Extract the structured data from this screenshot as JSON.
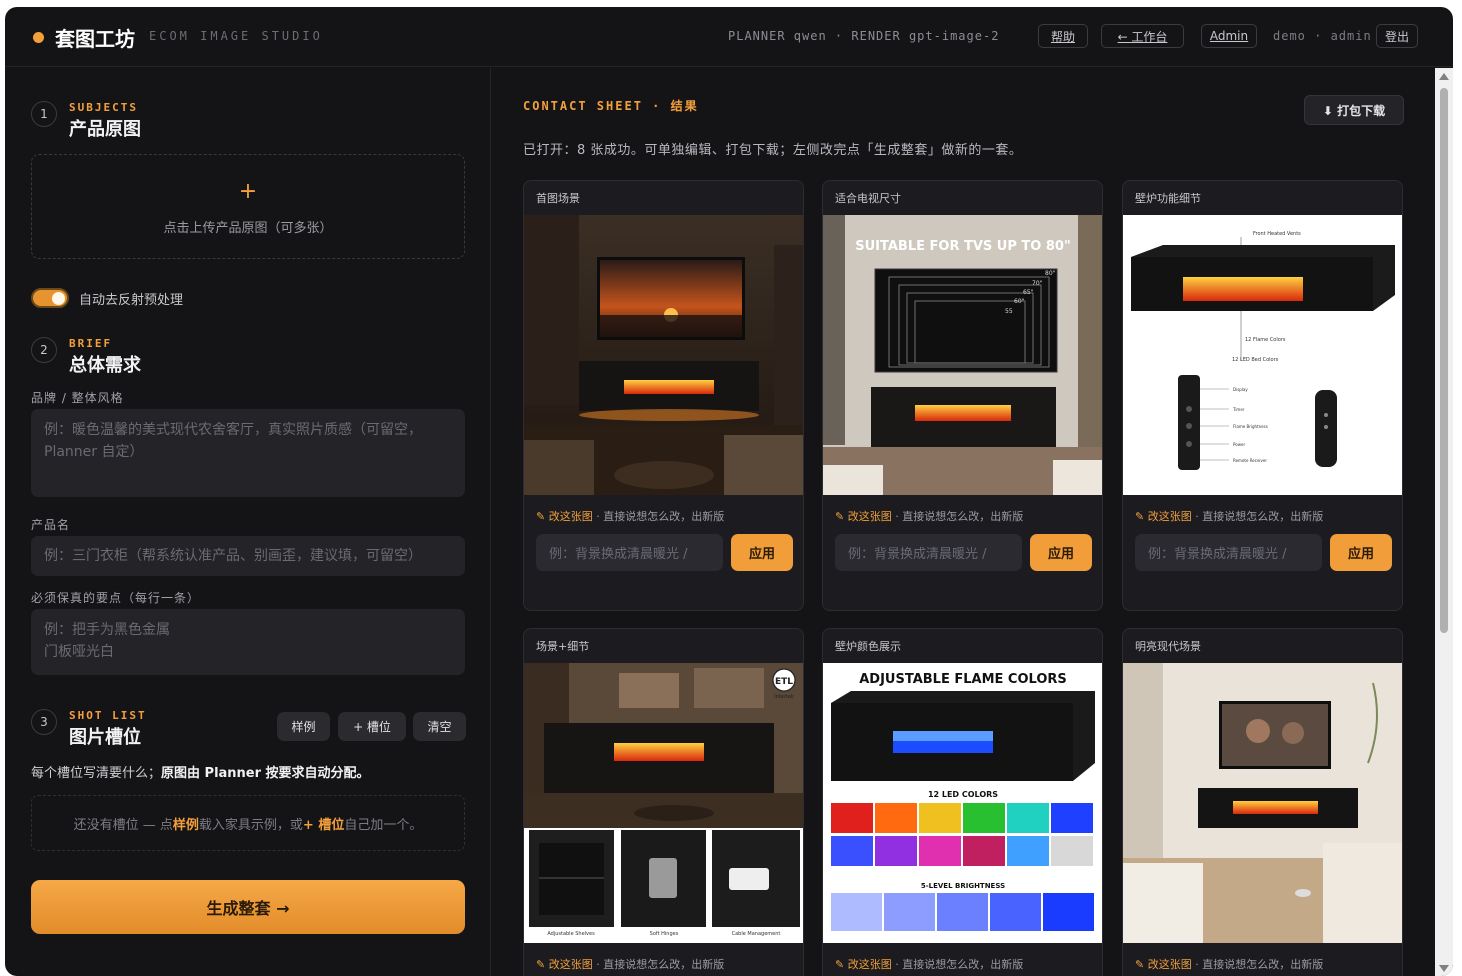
{
  "header": {
    "logo": "套图工坊",
    "subtitle": "ECOM IMAGE STUDIO",
    "model_info": "PLANNER qwen · RENDER gpt-image-2",
    "help": "帮助",
    "workspace": "← 工作台",
    "admin": "Admin",
    "user": "demo · admin",
    "logout": "登出"
  },
  "left": {
    "s1": {
      "num": "1",
      "kicker": "SUBJECTS",
      "title": "产品原图"
    },
    "upload": {
      "plus": "+",
      "text": "点击上传产品原图（可多张）"
    },
    "toggle": {
      "label": "自动去反射预处理",
      "on": true
    },
    "s2": {
      "num": "2",
      "kicker": "BRIEF",
      "title": "总体需求"
    },
    "brand_label": "品牌 / 整体风格",
    "brand_placeholder": "例：暖色温馨的美式现代农舍客厅，真实照片质感（可留空，Planner 自定）",
    "name_label": "产品名",
    "name_placeholder": "例：三门衣柜（帮系统认准产品、别画歪，建议填，可留空）",
    "keep_label": "必须保真的要点（每行一条）",
    "keep_placeholder_1": "例：把手为黑色金属",
    "keep_placeholder_2": "门板哑光白",
    "s3": {
      "num": "3",
      "kicker": "SHOT LIST",
      "title": "图片槽位"
    },
    "btn_example": "样例",
    "btn_add": "+ 槽位",
    "btn_clear": "清空",
    "shot_desc_a": "每个槽位写清要什么；",
    "shot_desc_b": "原图由 Planner 按要求自动分配。",
    "empty_a": "还没有槽位 — 点 ",
    "empty_b": "样例",
    "empty_c": " 载入家具示例，或 ",
    "empty_d": "+ 槽位",
    "empty_e": " 自己加一个。",
    "generate": "生成整套 →"
  },
  "right": {
    "title": "CONTACT SHEET · 结果",
    "download": "⬇ 打包下载",
    "status": "已打开：8 张成功。可单独编辑、打包下载；左侧改完点「生成整套」做新的一套。",
    "edit_label": "改这张图",
    "edit_hint": " · 直接说想怎么改，出新版",
    "input_placeholder": "例：背景换成清晨暖光 / ",
    "apply": "应用",
    "cards": [
      {
        "title": "首图场景"
      },
      {
        "title": "适合电视尺寸",
        "img_text": "SUITABLE FOR TVS UP TO 80\"",
        "sizes": [
          "80\"",
          "70\"",
          "65\"",
          "60\"",
          "55"
        ]
      },
      {
        "title": "壁炉功能细节",
        "callouts": [
          "Front Heated Vents",
          "12 Flame Colors",
          "12 LED Bed Colors",
          "Display",
          "Timer",
          "Flame Brightness",
          "Power",
          "Remote Receiver"
        ]
      },
      {
        "title": "场景+细节",
        "badge": "ETL",
        "badge_sub": "Intertek",
        "details": [
          "Adjustable Shelves",
          "Soft Hinges",
          "Cable Management"
        ]
      },
      {
        "title": "壁炉颜色展示",
        "img_title": "ADJUSTABLE FLAME COLORS",
        "led": "12 LED COLORS",
        "brightness": "5-LEVEL BRIGHTNESS"
      },
      {
        "title": "明亮现代场景"
      }
    ]
  }
}
